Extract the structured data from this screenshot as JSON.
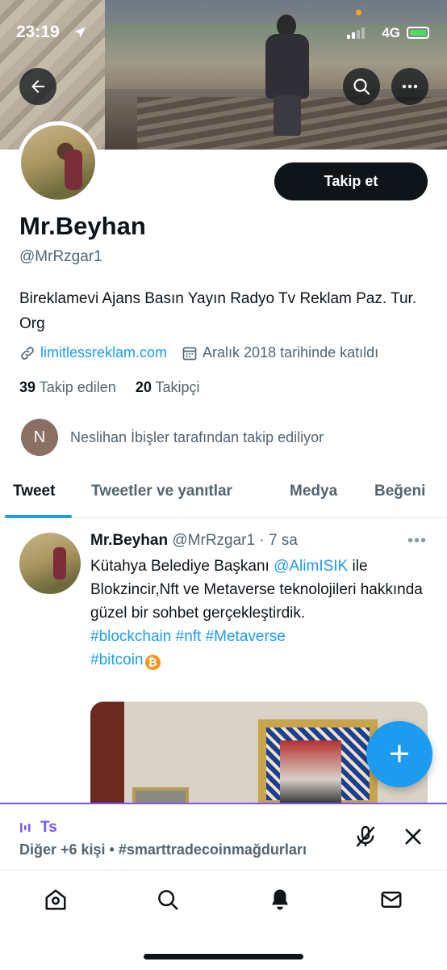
{
  "status_bar": {
    "time": "23:19",
    "network": "4G"
  },
  "profile": {
    "follow_label": "Takip et",
    "name": "Mr.Beyhan",
    "handle": "@MrRzgar1",
    "bio": "Bireklamevi Ajans Basın Yayın Radyo Tv Reklam Paz. Tur. Org",
    "website": "limitlessreklam.com",
    "joined": "Aralık 2018 tarihinde katıldı",
    "following_count": "39",
    "following_label": "Takip edilen",
    "followers_count": "20",
    "followers_label": "Takipçi",
    "followed_by_initial": "N",
    "followed_by_text": "Neslihan İbişler tarafından takip ediliyor"
  },
  "tabs": [
    {
      "label": "Tweet",
      "active": true
    },
    {
      "label": "Tweetler ve yanıtlar",
      "active": false
    },
    {
      "label": "Medya",
      "active": false
    },
    {
      "label": "Beğeni",
      "active": false
    }
  ],
  "tweet": {
    "author": "Mr.Beyhan",
    "handle_time": "@MrRzgar1 · 7 sa",
    "text_1": "Kütahya Belediye Başkanı ",
    "mention": "@AlimISIK",
    "text_2": " ile Blokzincir,Nft ve Metaverse teknolojileri hakkında güzel bir sohbet gerçekleştirdik.",
    "hashtags_line1": "#blockchain #nft #Metaverse",
    "hashtags_line2": "#bitcoin",
    "btc_glyph": "₿"
  },
  "spaces": {
    "title": "Ts",
    "subtitle": "Diğer +6 kişi • #smarttradecoinmağdurları"
  },
  "fab_label": "+",
  "colors": {
    "accent": "#1d9bf0",
    "spaces": "#7856ff",
    "text": "#0f1419",
    "muted": "#536471"
  },
  "icons": [
    "back-arrow-icon",
    "search-icon",
    "more-icon",
    "link-icon",
    "calendar-icon",
    "spaces-wave-icon",
    "mic-off-icon",
    "close-icon",
    "home-icon",
    "nav-search-icon",
    "bell-icon",
    "mail-icon"
  ]
}
